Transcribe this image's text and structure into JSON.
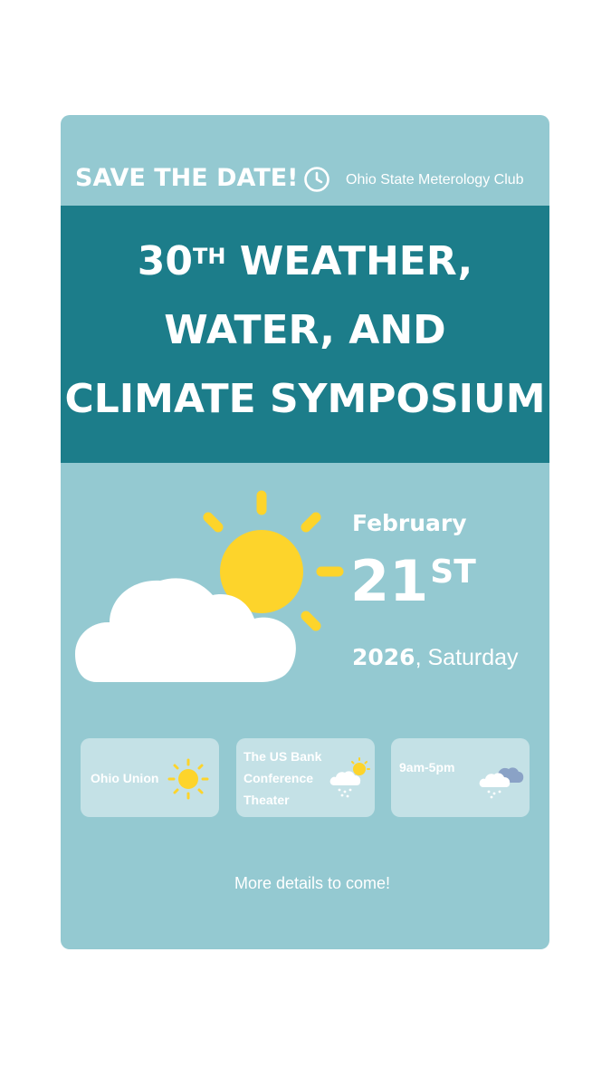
{
  "header": {
    "save_the_date": "SAVE THE DATE!",
    "club": "Ohio State Meterology Club",
    "clock_icon": "clock-icon"
  },
  "title": {
    "line1_num": "30",
    "line1_sup": "TH",
    "line1_rest": " WEATHER,",
    "line2": "WATER, AND",
    "line3": "CLIMATE SYMPOSIUM"
  },
  "date": {
    "month": "February",
    "day": "21",
    "day_suffix": "ST",
    "year": "2026",
    "weekday": ", Saturday"
  },
  "info": [
    {
      "label": "Ohio Union",
      "icon": "sun-icon"
    },
    {
      "label_lines": [
        "The US Bank",
        "Conference",
        "Theater"
      ],
      "icon": "rain-cloud-sun-icon"
    },
    {
      "label": "9am-5pm",
      "icon": "rain-cloud-icon"
    }
  ],
  "footer": {
    "more": "More details to come!"
  },
  "colors": {
    "background": "#ffffff",
    "card": "#94c9d1",
    "band": "#1c7d8a",
    "sun": "#fdd42b",
    "cloud": "#ffffff",
    "dark_cloud": "#8aa2c6"
  }
}
